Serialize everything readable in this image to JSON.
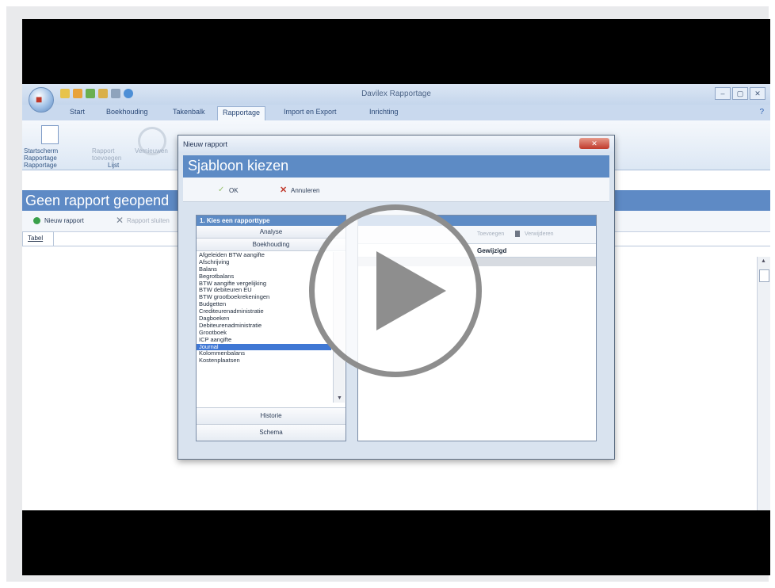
{
  "app": {
    "title": "Davilex Rapportage",
    "tabs": [
      "Start",
      "Boekhouding",
      "Takenbalk",
      "Rapportage",
      "Import en Export",
      "Inrichting"
    ],
    "active_tab": "Rapportage",
    "help_icon": "?",
    "window_buttons": [
      "–",
      "▢",
      "✕"
    ],
    "ribbon": {
      "start_button": "Startscherm Rapportage",
      "rapport_button": "Rapport toevoegen",
      "vernieuwen_button": "Vernieuwen",
      "group_rapportage": "Rapportage",
      "group_lijst": "Lijst"
    },
    "banner_title": "Geen rapport geopend",
    "toolbar": {
      "new_report": "Nieuw rapport",
      "rapport_sluiten": "Rapport sluiten"
    },
    "sheet_tab": "Tabel"
  },
  "dialog": {
    "window_title": "Nieuw rapport",
    "close_label": "✕",
    "heading": "Sjabloon kiezen",
    "ok_label": "OK",
    "cancel_label": "Annuleren",
    "left_panel": {
      "header": "1. Kies een rapporttype",
      "group_analyse": "Analyse",
      "group_boekhouding": "Boekhouding",
      "items": [
        "Afgeleiden BTW aangifte",
        "Afschrijving",
        "Balans",
        "Begrotbalans",
        "BTW aangifte vergelijking",
        "BTW debiteuren EU",
        "BTW grootboekrekeningen",
        "Budgetten",
        "Crediteurenadministratie",
        "Dagboeken",
        "Debiteurenadministratie",
        "Grootboek",
        "ICP aangifte",
        "Journal",
        "Kolommenbalans",
        "Kostenplaatsen"
      ],
      "selected_index": 13,
      "group_historie": "Historie",
      "group_schema": "Schema"
    },
    "right_panel": {
      "toolbar_add": "Toevoegen",
      "toolbar_delete": "Verwijderen",
      "column_gewijzigd": "Gewijzigd"
    }
  },
  "overlay": {
    "play_icon": "play-icon"
  }
}
